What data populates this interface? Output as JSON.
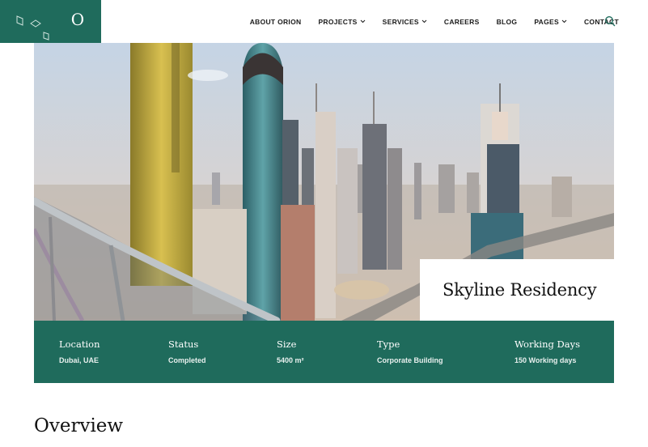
{
  "logo": {
    "letter": "O"
  },
  "nav": {
    "items": [
      {
        "label": "ABOUT ORION",
        "dropdown": false
      },
      {
        "label": "PROJECTS",
        "dropdown": true
      },
      {
        "label": "SERVICES",
        "dropdown": true
      },
      {
        "label": "CAREERS",
        "dropdown": false
      },
      {
        "label": "BLOG",
        "dropdown": false
      },
      {
        "label": "PAGES",
        "dropdown": true
      },
      {
        "label": "CONTACT",
        "dropdown": false
      }
    ],
    "search_icon": "search-icon"
  },
  "project": {
    "title": "Skyline Residency",
    "details": [
      {
        "label": "Location",
        "value": "Dubai, UAE"
      },
      {
        "label": "Status",
        "value": "Completed"
      },
      {
        "label": "Size",
        "value": "5400 m²"
      },
      {
        "label": "Type",
        "value": "Corporate Building"
      },
      {
        "label": "Working Days",
        "value": "150 Working days"
      }
    ]
  },
  "overview": {
    "heading": "Overview"
  },
  "colors": {
    "brand": "#1f6b5c",
    "text": "#111111",
    "background": "#ffffff"
  }
}
